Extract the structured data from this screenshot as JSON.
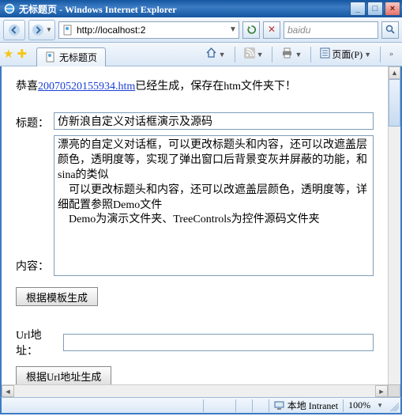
{
  "window": {
    "title": "无标题页 - Windows Internet Explorer"
  },
  "address": {
    "url": "http://localhost:2",
    "search_placeholder": "baidu"
  },
  "tab": {
    "label": "无标题页"
  },
  "toolbar": {
    "page_menu": "页面(P)"
  },
  "page": {
    "congrats_prefix": "恭喜",
    "generated_file": "20070520155934.htm",
    "congrats_suffix": "已经生成，保存在htm文件夹下！",
    "title_label": "标题：",
    "title_value": "仿新浪自定义对话框演示及源码",
    "content_label": "内容：",
    "content_value": "漂亮的自定义对话框，可以更改标题头和内容，还可以改遮盖层颜色，透明度等，实现了弹出窗口后背景变灰并屏蔽的功能，和sina的类似\n    可以更改标题头和内容，还可以改遮盖层颜色，透明度等，详细配置参照Demo文件\n    Demo为演示文件夹、TreeControls为控件源码文件夹",
    "gen_by_template_btn": "根据模板生成",
    "url_label": "Url地址：",
    "url_value": "",
    "gen_by_url_btn": "根据Url地址生成"
  },
  "status": {
    "zone": "本地 Intranet",
    "zoom": "100%"
  }
}
